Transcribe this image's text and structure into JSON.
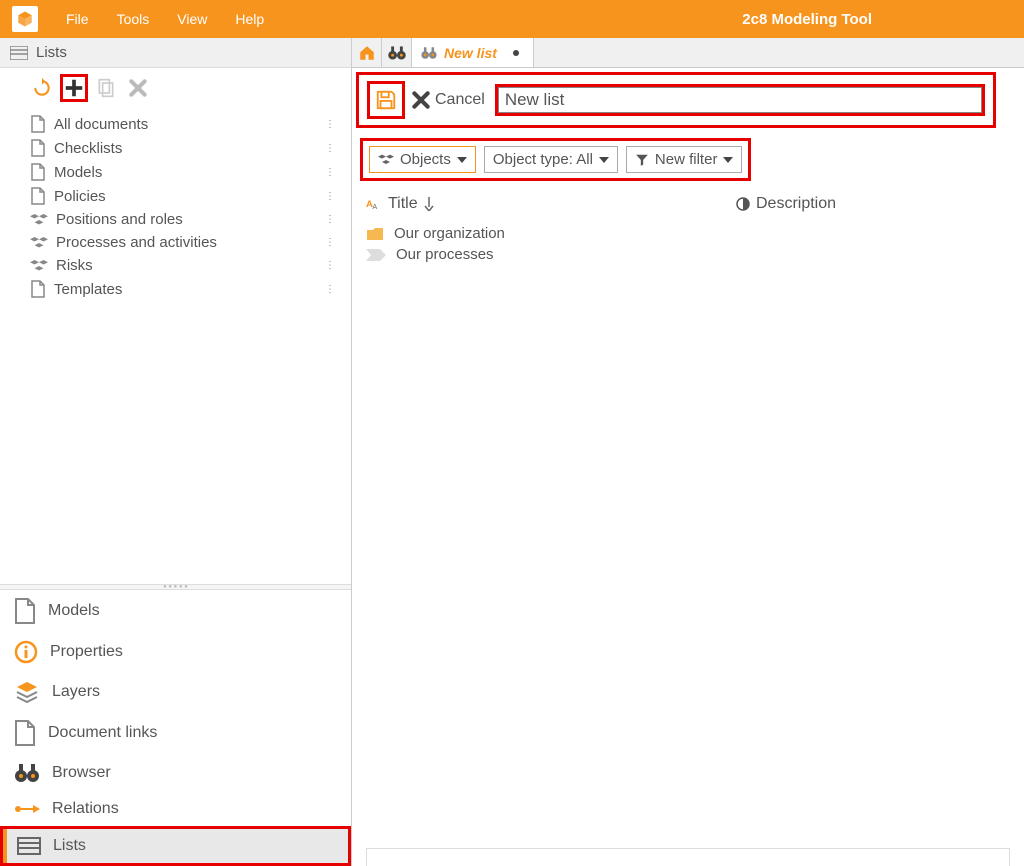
{
  "menubar": {
    "items": [
      "File",
      "Tools",
      "View",
      "Help"
    ],
    "app_title": "2c8 Modeling Tool"
  },
  "left_panel": {
    "header_label": "Lists",
    "categories": [
      {
        "label": "All documents",
        "icon": "document"
      },
      {
        "label": "Checklists",
        "icon": "document"
      },
      {
        "label": "Models",
        "icon": "document"
      },
      {
        "label": "Policies",
        "icon": "document"
      },
      {
        "label": "Positions and roles",
        "icon": "cubes"
      },
      {
        "label": "Processes and activities",
        "icon": "cubes"
      },
      {
        "label": "Risks",
        "icon": "cubes"
      },
      {
        "label": "Templates",
        "icon": "document"
      }
    ]
  },
  "bottom_nav": {
    "items": [
      {
        "label": "Models",
        "icon": "document"
      },
      {
        "label": "Properties",
        "icon": "info"
      },
      {
        "label": "Layers",
        "icon": "layers"
      },
      {
        "label": "Document links",
        "icon": "document"
      },
      {
        "label": "Browser",
        "icon": "binoculars"
      },
      {
        "label": "Relations",
        "icon": "relations"
      },
      {
        "label": "Lists",
        "icon": "list",
        "active": true
      }
    ]
  },
  "tabs": {
    "active_label": "New list"
  },
  "editor": {
    "cancel_label": "Cancel",
    "title_value": "New list"
  },
  "filters": {
    "objects_label": "Objects",
    "type_label": "Object type: All",
    "new_filter_label": "New filter"
  },
  "columns": {
    "title": "Title",
    "description": "Description"
  },
  "results": [
    {
      "label": "Our organization",
      "icon": "folder"
    },
    {
      "label": "Our processes",
      "icon": "arrow-tag"
    }
  ]
}
